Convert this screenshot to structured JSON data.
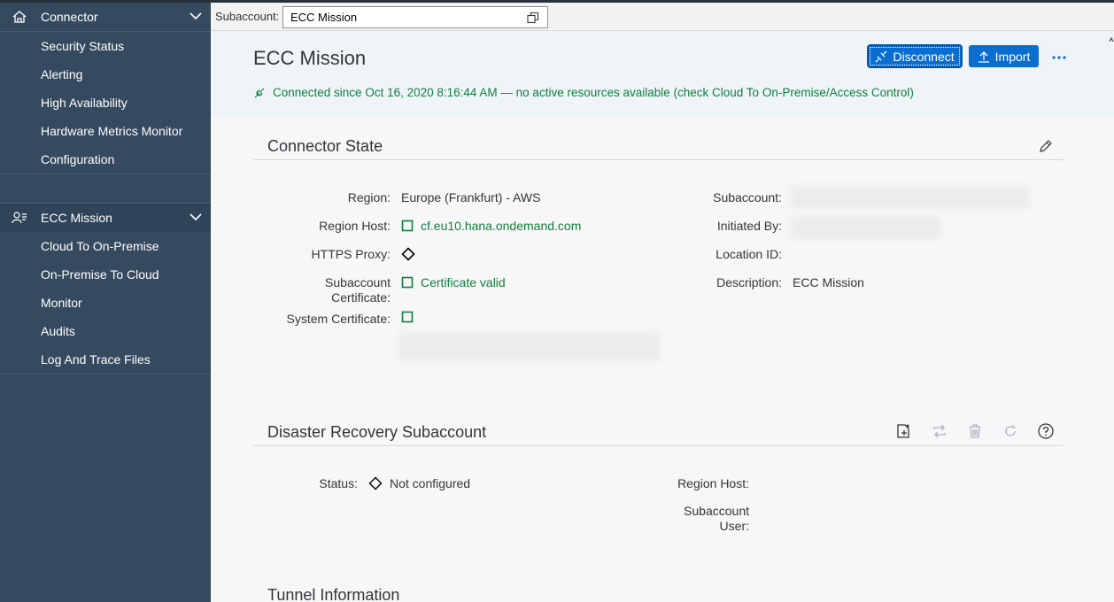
{
  "sidebar": {
    "groups": [
      {
        "label": "Connector",
        "items": [
          "Security Status",
          "Alerting",
          "High Availability",
          "Hardware Metrics Monitor",
          "Configuration"
        ]
      },
      {
        "label": "ECC Mission",
        "items": [
          "Cloud To On-Premise",
          "On-Premise To Cloud",
          "Monitor",
          "Audits",
          "Log And Trace Files"
        ]
      }
    ]
  },
  "topbar": {
    "subaccount_label": "Subaccount:",
    "subaccount_value": "ECC Mission"
  },
  "header": {
    "title": "ECC Mission",
    "status_text": "Connected since Oct 16, 2020 8:16:44 AM — no active resources available (check Cloud To On-Premise/Access Control)",
    "disconnect_label": "Disconnect",
    "import_label": "Import"
  },
  "connector_state": {
    "title": "Connector State",
    "region_label": "Region:",
    "region_value": "Europe (Frankfurt) - AWS",
    "region_host_label": "Region Host:",
    "region_host_value": "cf.eu10.hana.ondemand.com",
    "https_proxy_label": "HTTPS Proxy:",
    "subaccount_cert_label_1": "Subaccount",
    "subaccount_cert_label_2": "Certificate:",
    "subaccount_cert_value": "Certificate valid",
    "system_cert_label": "System Certificate:",
    "subaccount_label": "Subaccount:",
    "initiated_by_label": "Initiated By:",
    "location_id_label": "Location ID:",
    "description_label": "Description:",
    "description_value": "ECC Mission"
  },
  "disaster_recovery": {
    "title": "Disaster Recovery Subaccount",
    "status_label": "Status:",
    "status_value": "Not configured",
    "region_host_label": "Region Host:",
    "subaccount_user_label_1": "Subaccount",
    "subaccount_user_label_2": "User:"
  },
  "tunnel": {
    "title": "Tunnel Information"
  },
  "colors": {
    "sidebar_bg": "#354a5f",
    "accent": "#0a6ed1",
    "positive": "#107e3e",
    "header_bg": "#eff4f9"
  }
}
